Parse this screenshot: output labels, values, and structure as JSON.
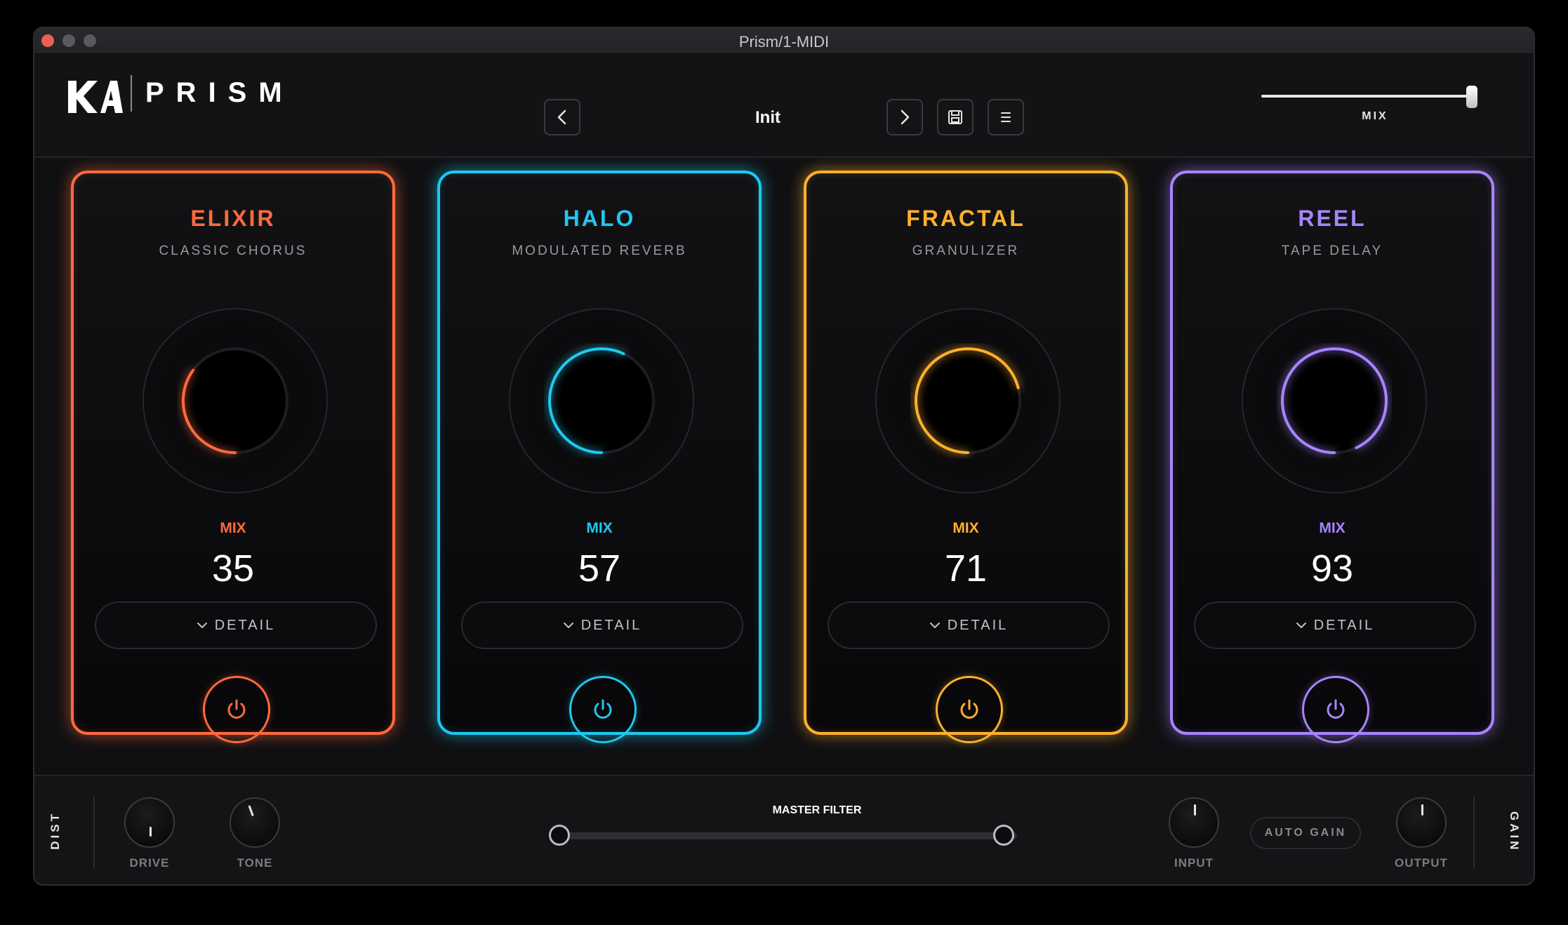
{
  "window": {
    "title": "Prism/1-MIDI"
  },
  "header": {
    "brand": "PRISM",
    "preset_name": "Init",
    "prev_icon": "chevron-left-icon",
    "next_icon": "chevron-right-icon",
    "save_icon": "save-icon",
    "menu_icon": "menu-icon",
    "mix_label": "MIX",
    "mix_value_fraction": 1.0
  },
  "modules": [
    {
      "name": "ELIXIR",
      "subtitle": "CLASSIC CHORUS",
      "mix_label": "MIX",
      "mix": "35",
      "detail_label": "DETAIL",
      "color": "#ff6a3d"
    },
    {
      "name": "HALO",
      "subtitle": "MODULATED REVERB",
      "mix_label": "MIX",
      "mix": "57",
      "detail_label": "DETAIL",
      "color": "#20c8f0"
    },
    {
      "name": "FRACTAL",
      "subtitle": "GRANULIZER",
      "mix_label": "MIX",
      "mix": "71",
      "detail_label": "DETAIL",
      "color": "#ffb02e"
    },
    {
      "name": "REEL",
      "subtitle": "TAPE DELAY",
      "mix_label": "MIX",
      "mix": "93",
      "detail_label": "DETAIL",
      "color": "#a884ff"
    }
  ],
  "footer": {
    "dist_label": "DIST",
    "drive_label": "DRIVE",
    "tone_label": "TONE",
    "master_filter_label": "MASTER FILTER",
    "input_label": "INPUT",
    "auto_gain_label": "AUTO GAIN",
    "output_label": "OUTPUT",
    "gain_label": "GAIN"
  }
}
